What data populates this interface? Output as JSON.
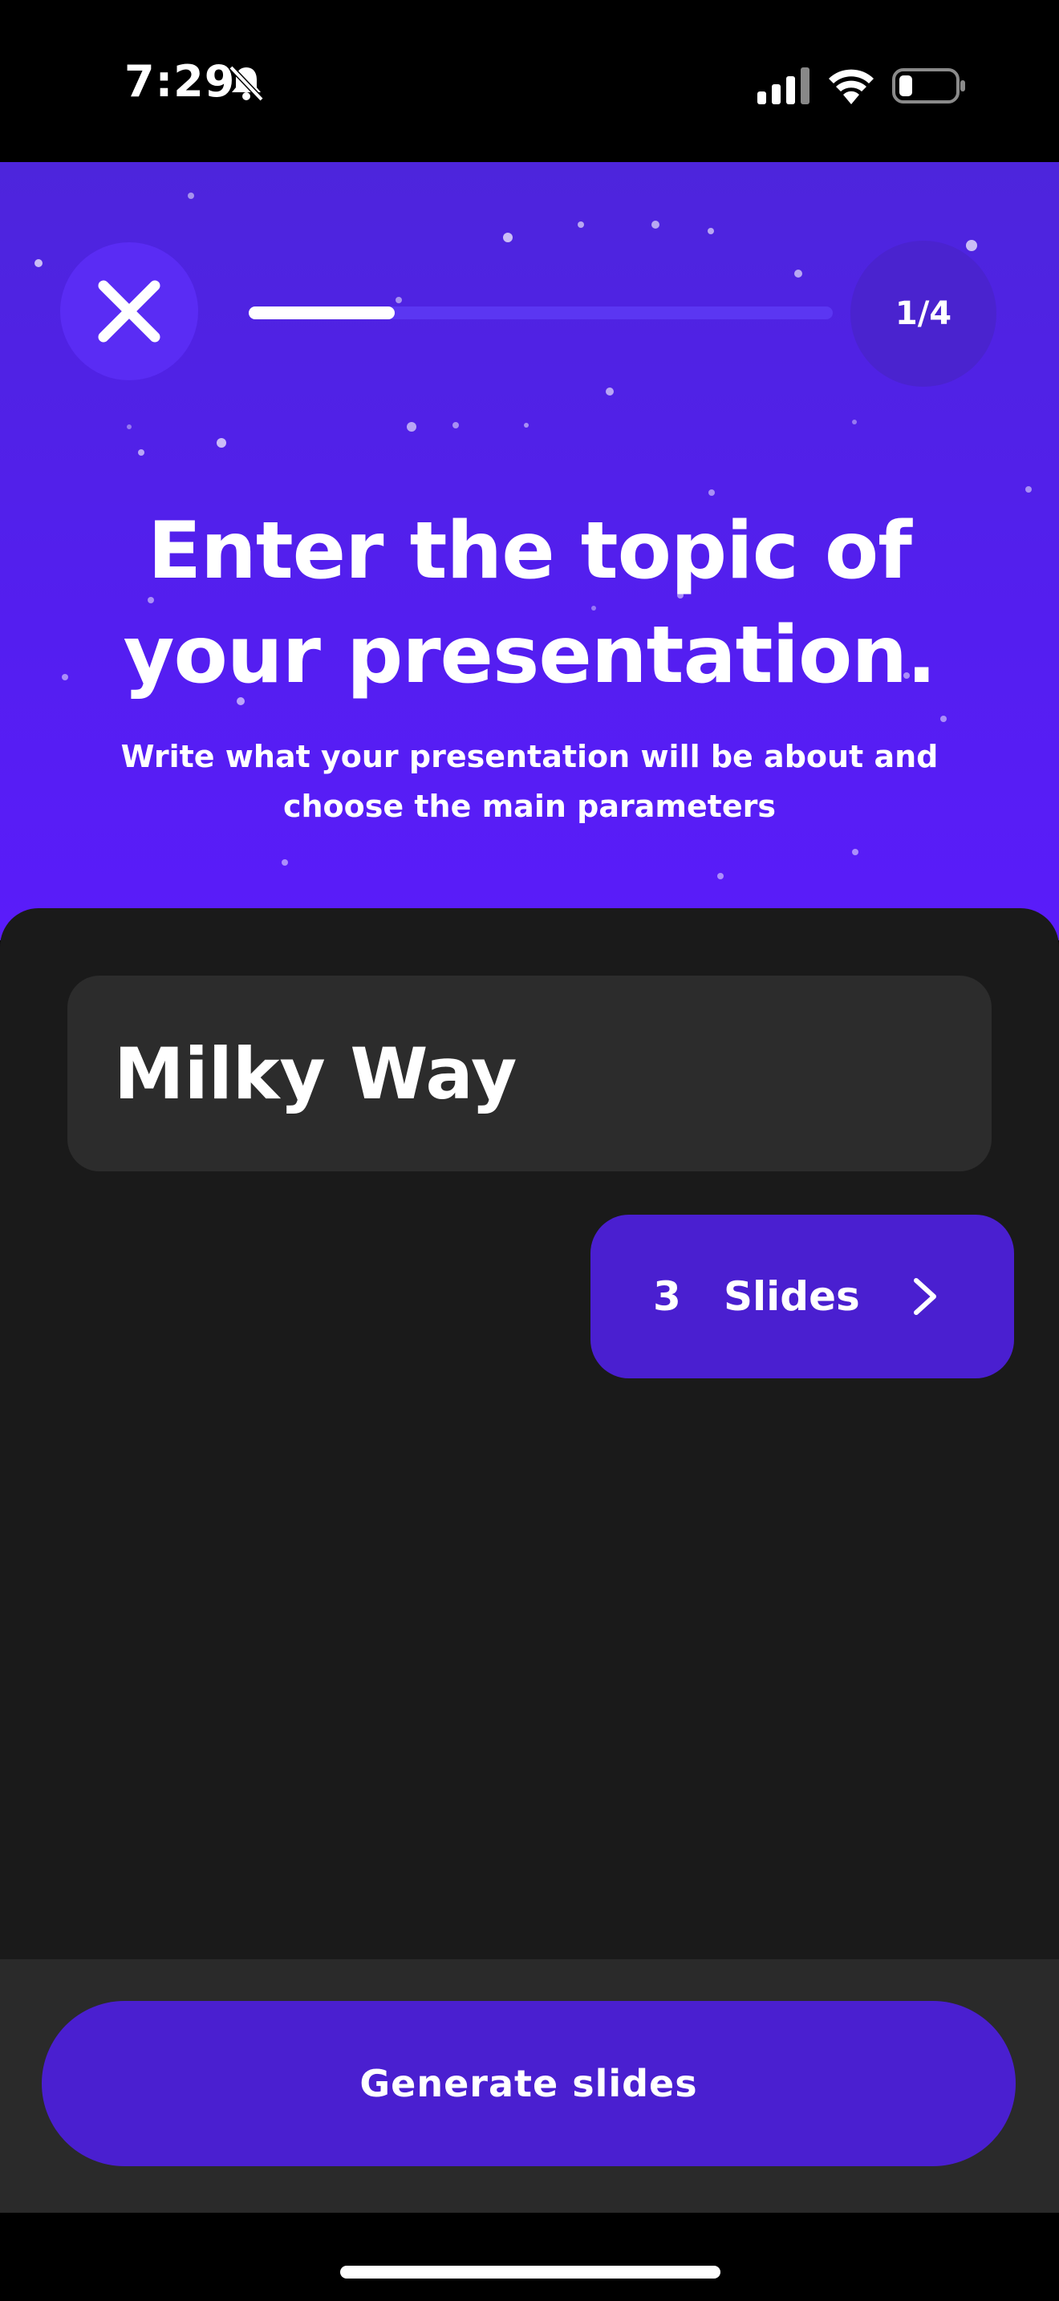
{
  "status_bar": {
    "time": "7:29"
  },
  "header": {
    "close_icon": "close-icon",
    "progress": {
      "fraction": 0.25
    },
    "step": "1/4",
    "title": "Enter the topic of your presentation.",
    "subtitle": "Write what your presentation will be about and choose the main parameters"
  },
  "form": {
    "topic_value": "Milky Way",
    "slides": {
      "count": "3",
      "label": "Slides"
    }
  },
  "footer": {
    "generate_label": "Generate slides"
  },
  "colors": {
    "header_purple": "#541ef0",
    "button_purple": "#4a1fd0",
    "panel": "#1a1a1a",
    "field": "#2c2c2c"
  }
}
